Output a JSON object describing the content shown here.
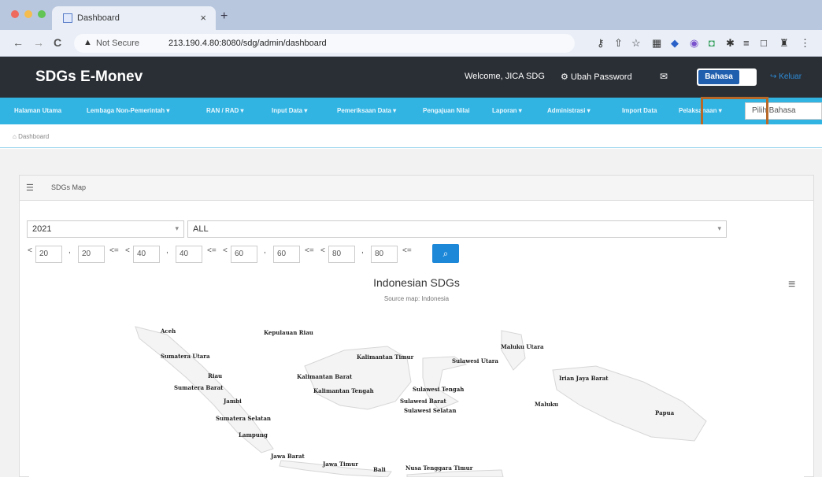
{
  "browser": {
    "tab_title": "Dashboard",
    "tab_close": "×",
    "new_tab": "+",
    "not_secure": "Not Secure",
    "url": "213.190.4.80:8080/sdg/admin/dashboard",
    "back": "←",
    "forward": "→",
    "reload": "C"
  },
  "header": {
    "brand": "SDGs E-Monev",
    "welcome": "Welcome, JICA SDG",
    "change_password": "Ubah Password",
    "language_toggle": "Bahasa",
    "logout": "Keluar"
  },
  "menu": {
    "items": [
      "Halaman Utama",
      "Lembaga Non-Pemerintah ▾",
      "RAN / RAD ▾",
      "Input Data ▾",
      "Pemeriksaan Data ▾",
      "Pengajuan Nilai",
      "Laporan ▾",
      "Administrasi ▾",
      "Import Data",
      "Pelaksanaan ▾"
    ],
    "language_select_placeholder": "Pilih Bahasa"
  },
  "breadcrumb": "Dashboard",
  "card": {
    "title": "SDGs Map",
    "year": "2021",
    "region": "ALL",
    "ranges": {
      "lt": "<",
      "le": "<=",
      "comma": ",",
      "v1": "20",
      "v2": "20",
      "v3": "40",
      "v4": "40",
      "v5": "60",
      "v6": "60",
      "v7": "80",
      "v8": "80"
    }
  },
  "chart": {
    "title": "Indonesian SDGs",
    "subtitle": "Source map: Indonesia"
  },
  "provinces": [
    "Aceh",
    "Kepulauan Riau",
    "Sumatera Utara",
    "Kalimantan Timur",
    "Sulawesi Utara",
    "Maluku Utara",
    "Riau",
    "Kalimantan Barat",
    "Irian Jaya Barat",
    "Sumatera Barat",
    "Kalimantan Tengah",
    "Sulawesi Tengah",
    "Jambi",
    "Sulawesi Barat",
    "Maluku",
    "Sulawesi Selatan",
    "Papua",
    "Sumatera Selatan",
    "Lampung",
    "Jawa Barat",
    "Jawa Timur",
    "Bali",
    "Nusa Tenggara Timur"
  ]
}
